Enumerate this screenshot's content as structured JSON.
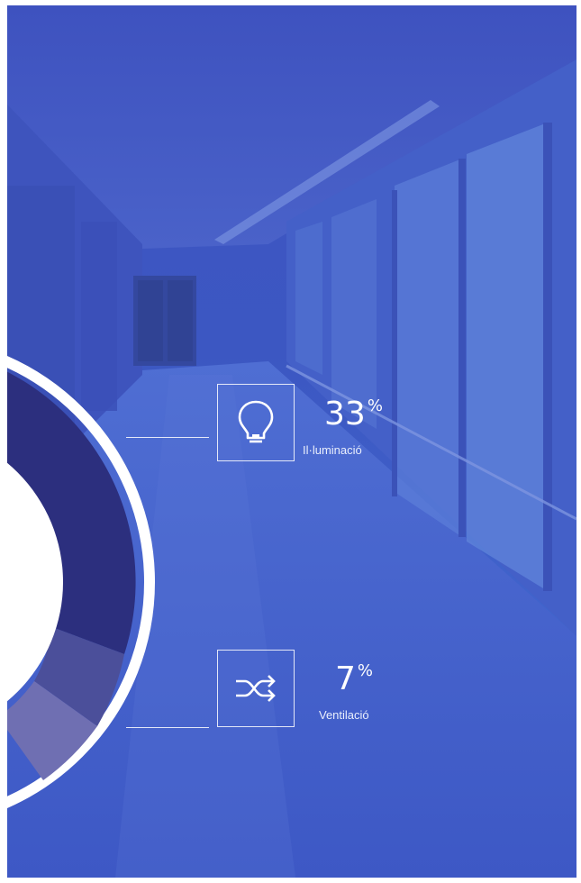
{
  "stats": [
    {
      "value": "33",
      "unit": "%",
      "label": "Il·luminació",
      "icon": "lightbulb-icon"
    },
    {
      "value": "7",
      "unit": "%",
      "label": "Ventilació",
      "icon": "shuffle-arrows-icon"
    }
  ],
  "colors": {
    "background_blue": "#3f55c1",
    "donut_dark": "#2c2f7e",
    "donut_mid": "#4b4f9a",
    "donut_light": "#6f6fb2",
    "white": "#ffffff"
  }
}
